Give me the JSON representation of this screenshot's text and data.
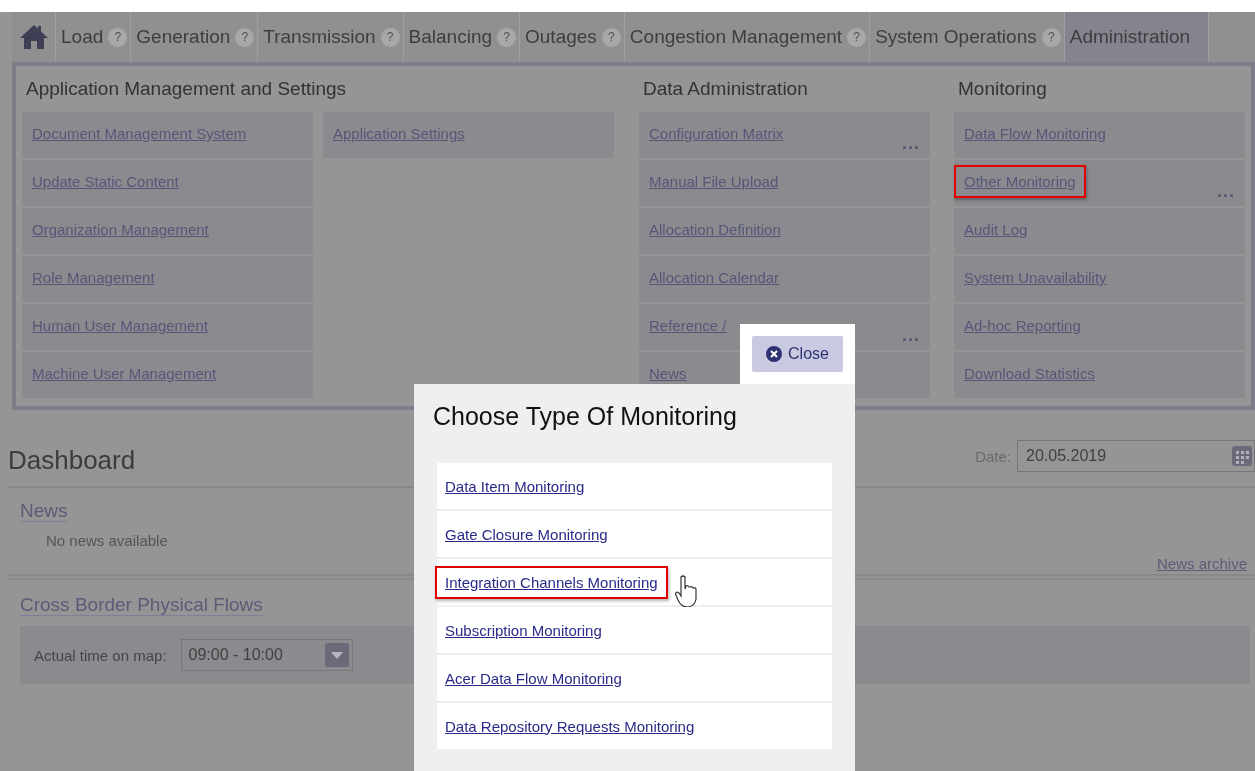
{
  "nav": {
    "tabs": [
      {
        "label": "Load",
        "help": "?",
        "selected": false
      },
      {
        "label": "Generation",
        "help": "?",
        "selected": false
      },
      {
        "label": "Transmission",
        "help": "?",
        "selected": false
      },
      {
        "label": "Balancing",
        "help": "?",
        "selected": false
      },
      {
        "label": "Outages",
        "help": "?",
        "selected": false
      },
      {
        "label": "Congestion Management",
        "help": "?",
        "selected": false
      },
      {
        "label": "System Operations",
        "help": "?",
        "selected": false
      },
      {
        "label": "Administration",
        "selected": true
      }
    ]
  },
  "menu": {
    "columns": [
      {
        "heading": "Application Management and Settings",
        "lists": [
          [
            {
              "label": "Document Management System",
              "highlighted": false
            },
            {
              "label": "Update Static Content",
              "highlighted": false
            },
            {
              "label": "Organization Management",
              "highlighted": false
            },
            {
              "label": "Role Management",
              "highlighted": false
            },
            {
              "label": "Human User Management",
              "highlighted": false
            },
            {
              "label": "Machine User Management",
              "highlighted": false
            }
          ],
          [
            {
              "label": "Application Settings",
              "highlighted": false
            }
          ]
        ]
      },
      {
        "heading": "Data Administration",
        "lists": [
          [
            {
              "label": "Configuration Matrix",
              "more": "...",
              "highlighted": false
            },
            {
              "label": "Manual File Upload",
              "highlighted": false
            },
            {
              "label": "Allocation Definition",
              "highlighted": false
            },
            {
              "label": "Allocation Calendar",
              "highlighted": false
            },
            {
              "label": "Reference /",
              "more": "...",
              "highlighted": false
            },
            {
              "label": "News",
              "highlighted": false
            }
          ]
        ]
      },
      {
        "heading": "Monitoring",
        "lists": [
          [
            {
              "label": "Data Flow Monitoring",
              "highlighted": false
            },
            {
              "label": "Other Monitoring",
              "more": "...",
              "highlighted": true
            },
            {
              "label": "Audit Log",
              "highlighted": false
            },
            {
              "label": "System Unavailability",
              "highlighted": false
            },
            {
              "label": "Ad-hoc Reporting",
              "highlighted": false
            },
            {
              "label": "Download Statistics",
              "highlighted": false
            }
          ]
        ]
      }
    ]
  },
  "dashboard": {
    "title": "Dashboard",
    "date_label": "Date:",
    "date_value": "20.05.2019",
    "news": {
      "title": "News",
      "empty": "No news available",
      "archive": "News archive"
    },
    "flows": {
      "title": "Cross Border Physical Flows",
      "time_label": "Actual time on map:",
      "time_value": "09:00 - 10:00"
    }
  },
  "modal": {
    "close": "Close",
    "title": "Choose Type Of Monitoring",
    "items": [
      {
        "label": "Data Item Monitoring",
        "highlighted": false,
        "pointer": false
      },
      {
        "label": "Gate Closure Monitoring",
        "highlighted": false,
        "pointer": false
      },
      {
        "label": "Integration Channels Monitoring",
        "highlighted": true,
        "pointer": true
      },
      {
        "label": "Subscription Monitoring",
        "highlighted": false,
        "pointer": false
      },
      {
        "label": "Acer Data Flow Monitoring",
        "highlighted": false,
        "pointer": false
      },
      {
        "label": "Data Repository Requests Monitoring",
        "highlighted": false,
        "pointer": false
      }
    ]
  }
}
